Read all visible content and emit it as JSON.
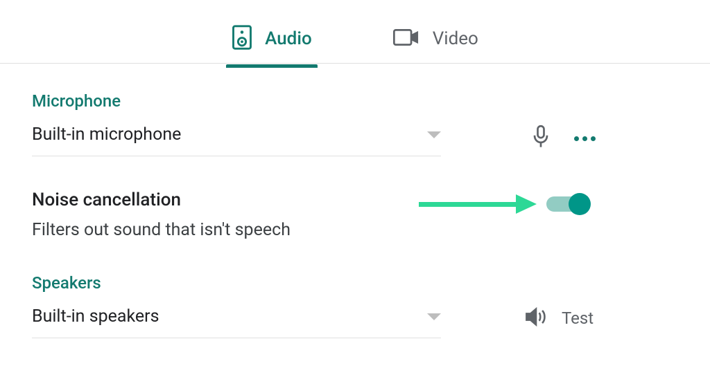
{
  "tabs": {
    "audio": "Audio",
    "video": "Video"
  },
  "microphone": {
    "title": "Microphone",
    "selected": "Built-in microphone"
  },
  "noise": {
    "title": "Noise cancellation",
    "description": "Filters out sound that isn't speech",
    "enabled": true
  },
  "speakers": {
    "title": "Speakers",
    "selected": "Built-in speakers",
    "test_label": "Test"
  },
  "colors": {
    "accent": "#137a6f",
    "toggle_on": "#009688",
    "arrow": "#2dd896"
  }
}
